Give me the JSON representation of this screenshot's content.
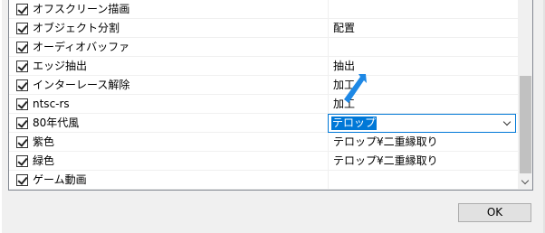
{
  "settings_list": {
    "items": [
      {
        "name": "オフスクリーン描画",
        "value": "",
        "checked": true
      },
      {
        "name": "オブジェクト分割",
        "value": "配置",
        "checked": true
      },
      {
        "name": "オーディオバッファ",
        "value": "",
        "checked": true
      },
      {
        "name": "エッジ抽出",
        "value": "抽出",
        "checked": true
      },
      {
        "name": "インターレース解除",
        "value": "加工",
        "checked": true
      },
      {
        "name": "ntsc-rs",
        "value": "加工",
        "checked": true
      },
      {
        "name": "80年代風",
        "value": "テロップ",
        "checked": true
      },
      {
        "name": "紫色",
        "value": "テロップ¥二重縁取り",
        "checked": true
      },
      {
        "name": "緑色",
        "value": "テロップ¥二重縁取り",
        "checked": true
      },
      {
        "name": "ゲーム動画",
        "value": "",
        "checked": true
      }
    ]
  },
  "footer": {
    "ok_label": "OK"
  },
  "colors": {
    "accent": "#0078d7",
    "cursor": "#1e88e5"
  },
  "icons": {
    "cursor": "cursor-arrow-icon",
    "dropdown": "chevron-down-icon"
  }
}
